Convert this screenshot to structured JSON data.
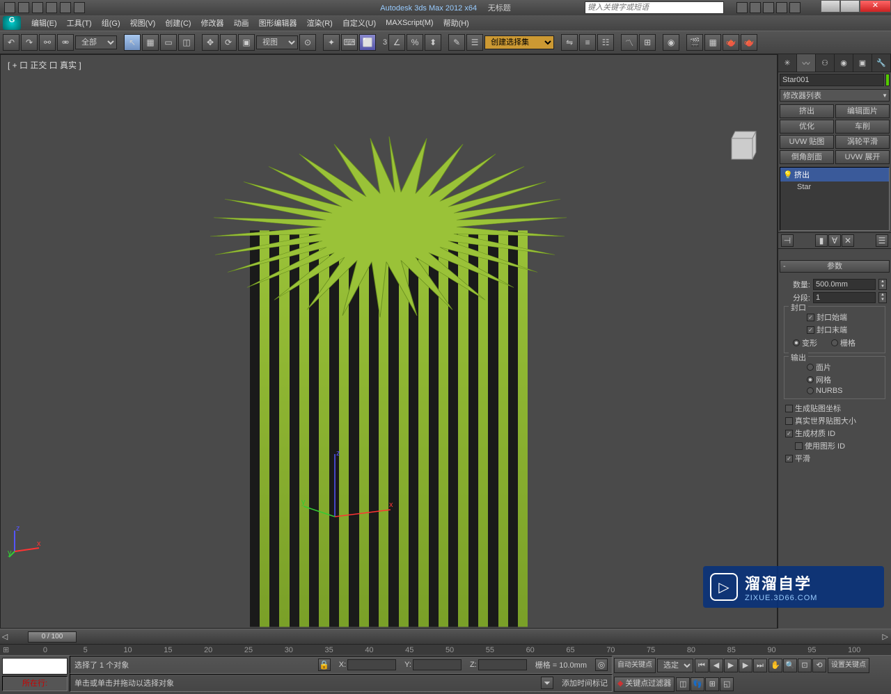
{
  "titlebar": {
    "app_title": "Autodesk 3ds Max  2012 x64",
    "doc_title": "无标题",
    "search_placeholder": "键入关键字或短语"
  },
  "menu": {
    "items": [
      "编辑(E)",
      "工具(T)",
      "组(G)",
      "视图(V)",
      "创建(C)",
      "修改器",
      "动画",
      "图形编辑器",
      "渲染(R)",
      "自定义(U)",
      "MAXScript(M)",
      "帮助(H)"
    ]
  },
  "toolbar": {
    "select_filter": "全部",
    "view_ref": "视图",
    "named_sel": "创建选择集",
    "angle_snap": "3"
  },
  "viewport": {
    "label": "[ + 口 正交 口 真实    ]",
    "gizmo": {
      "x": "x",
      "y": "y",
      "z": "z"
    }
  },
  "cmd": {
    "obj_name": "Star001",
    "mod_list_label": "修改器列表",
    "mod_buttons": [
      "挤出",
      "编辑面片",
      "优化",
      "车削",
      "UVW 贴图",
      "涡轮平滑",
      "倒角剖面",
      "UVW 展开"
    ],
    "stack": {
      "item0": "挤出",
      "item1": "Star"
    },
    "rollout_title": "参数",
    "amount_label": "数量:",
    "amount_value": "500.0mm",
    "segments_label": "分段:",
    "segments_value": "1",
    "capping_group": "封口",
    "cap_start": "封口始端",
    "cap_end": "封口末端",
    "morph": "变形",
    "grid": "栅格",
    "output_group": "输出",
    "output_patch": "面片",
    "output_mesh": "网格",
    "output_nurbs": "NURBS",
    "gen_map": "生成贴图坐标",
    "real_world": "真实世界贴图大小",
    "gen_mat_id": "生成材质 ID",
    "use_shape_id": "使用图形 ID",
    "smooth": "平滑"
  },
  "timeline": {
    "slider": "0 / 100",
    "ticks": [
      "0",
      "5",
      "10",
      "15",
      "20",
      "25",
      "30",
      "35",
      "40",
      "45",
      "50",
      "55",
      "60",
      "65",
      "70",
      "75",
      "80",
      "85",
      "90",
      "95",
      "100"
    ]
  },
  "status": {
    "row_label": "所在行:",
    "selected": "选择了 1 个对象",
    "prompt": "单击或单击并拖动以选择对象",
    "grid": "栅格 = 10.0mm",
    "add_time_tag": "添加时间标记",
    "auto_key": "自动关键点",
    "set_key": "设置关键点",
    "selected_combo": "选定对",
    "key_filter": "关键点过滤器",
    "x_label": "X:",
    "y_label": "Y:",
    "z_label": "Z:"
  },
  "watermark": {
    "main": "溜溜自学",
    "sub": "ZIXUE.3D66.COM"
  }
}
